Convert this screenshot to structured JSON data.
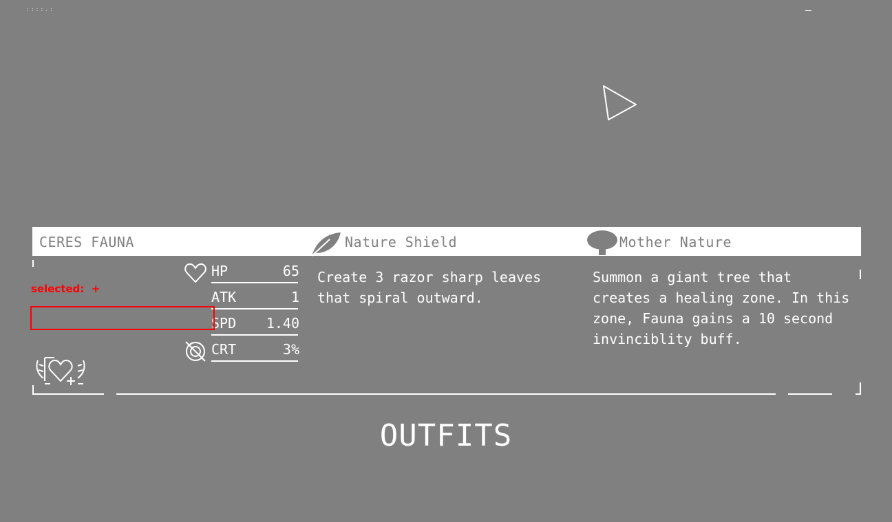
{
  "top_left_text": "::::.:",
  "character": {
    "name": "CERES FAUNA"
  },
  "stats": [
    {
      "label": "HP",
      "value": "65",
      "icon": "heart-outline-icon"
    },
    {
      "label": "ATK",
      "value": "1",
      "icon": ""
    },
    {
      "label": "SPD",
      "value": "1.40",
      "icon": ""
    },
    {
      "label": "CRT",
      "value": "3%",
      "icon": "crit-swirl-icon"
    }
  ],
  "skills": {
    "skill1": {
      "name": "Nature Shield",
      "icon": "leaf-icon",
      "description": "Create 3 razor sharp leaves\nthat spiral outward."
    },
    "skill2": {
      "name": "Mother Nature",
      "icon": "tree-icon",
      "description": "Summon a giant tree that\ncreates a healing zone. In this\nzone, Fauna gains a 10 second\ninvinciblity buff."
    }
  },
  "debug": {
    "selected_label": "selected:  +"
  },
  "outfits_label": "OUTFITS",
  "colors": {
    "background": "#808080",
    "foreground": "#ffffff",
    "debug": "#ff0000"
  }
}
